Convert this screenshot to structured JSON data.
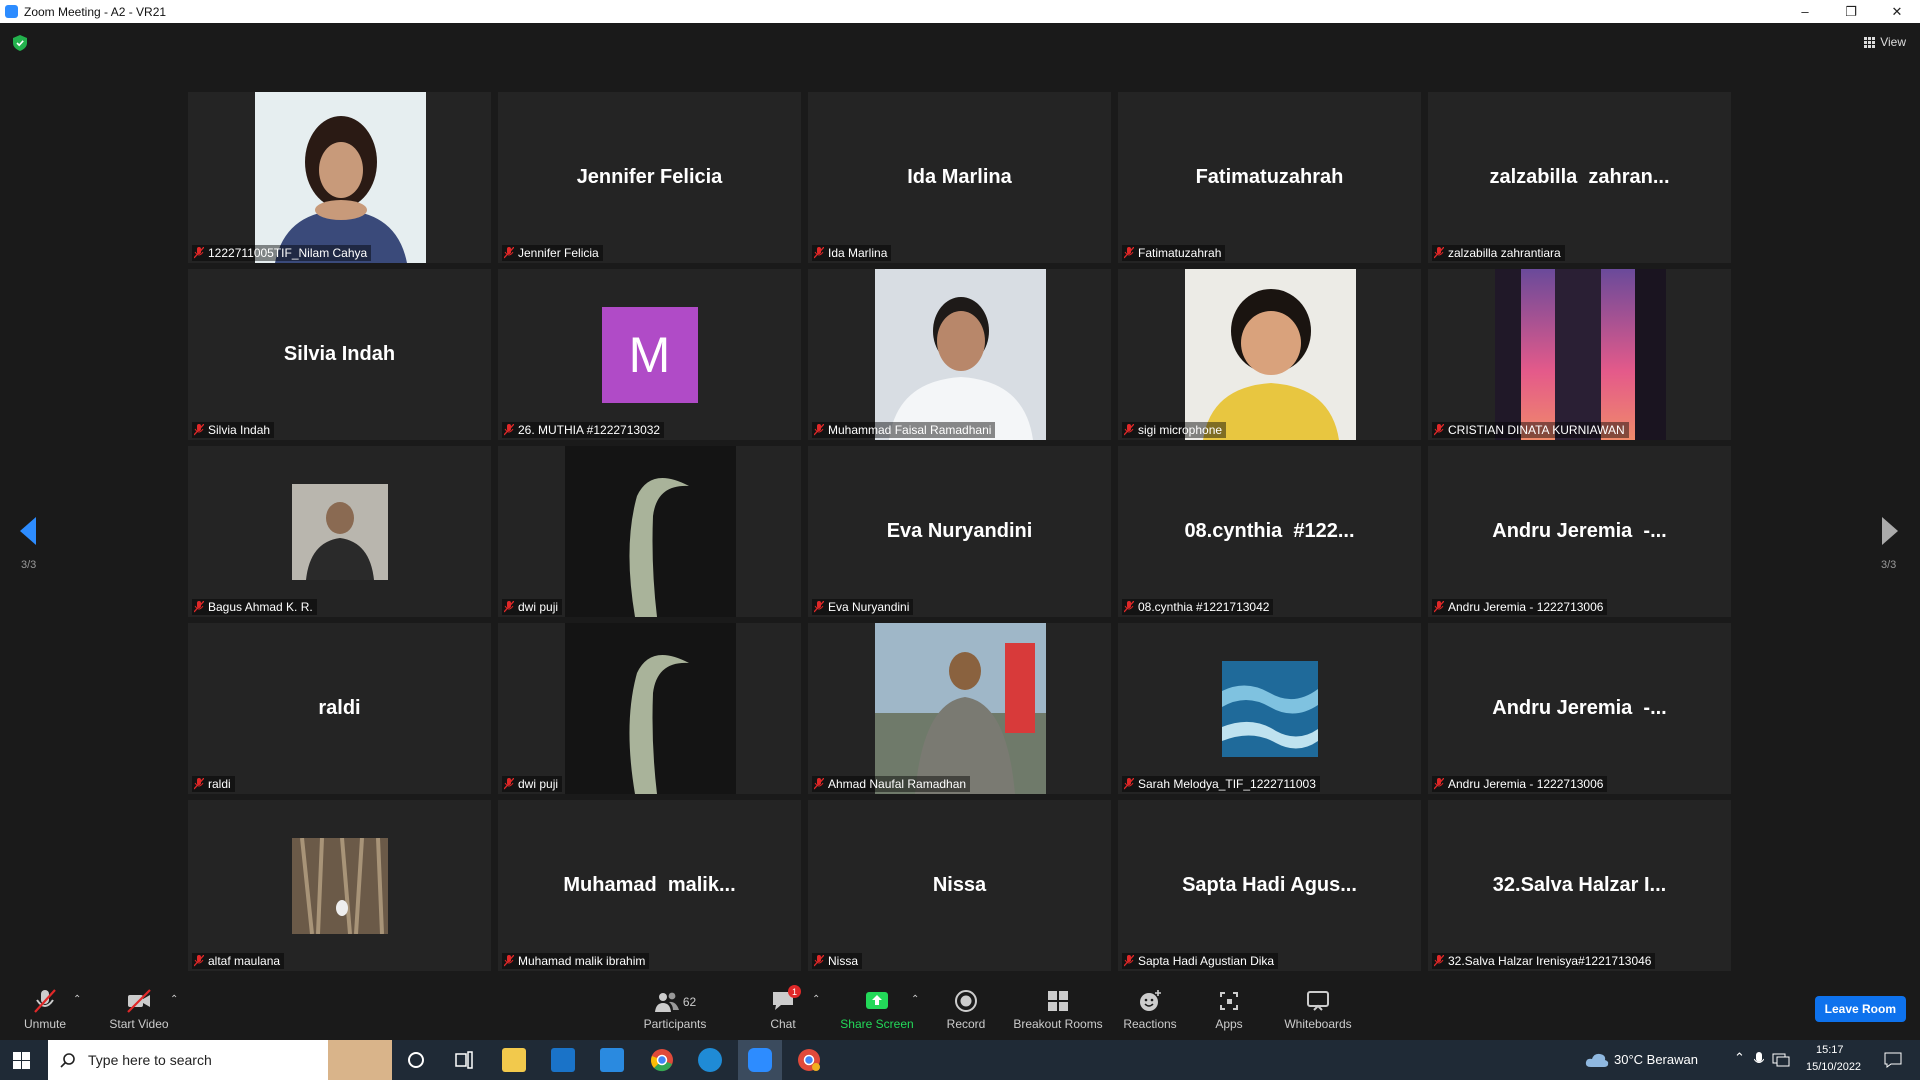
{
  "window": {
    "title": "Zoom Meeting - A2 - VR21",
    "minimize": "–",
    "restore": "❐",
    "close": "✕"
  },
  "header": {
    "view_label": "View"
  },
  "pager": {
    "left_indicator": "3/3",
    "right_indicator": "3/3"
  },
  "tiles": [
    {
      "display": "",
      "label": "1222711005TIF_Nilam Cahya",
      "video": "portrait-girl"
    },
    {
      "display": "Jennifer Felicia",
      "label": "Jennifer Felicia"
    },
    {
      "display": "Ida Marlina",
      "label": "Ida Marlina"
    },
    {
      "display": "Fatimatuzahrah",
      "label": "Fatimatuzahrah"
    },
    {
      "display": "zalzabilla  zahran...",
      "label": "zalzabilla zahrantiara"
    },
    {
      "display": "Silvia Indah",
      "label": "Silvia Indah"
    },
    {
      "display": "",
      "label": "26. MUTHIA #1222713032",
      "letter": "M"
    },
    {
      "display": "",
      "label": "Muhammad Faisal Ramadhani",
      "video": "portrait-man"
    },
    {
      "display": "",
      "label": "sigi microphone",
      "video": "child"
    },
    {
      "display": "",
      "label": "CRISTIAN DINATA KURNIAWAN",
      "video": "sunset-building"
    },
    {
      "display": "",
      "label": "Bagus Ahmad K. R.",
      "video": "small-photo"
    },
    {
      "display": "",
      "label": "dwi puji",
      "video": "leaf"
    },
    {
      "display": "Eva Nuryandini",
      "label": "Eva Nuryandini"
    },
    {
      "display": "08.cynthia  #122...",
      "label": "08.cynthia #1221713042"
    },
    {
      "display": "Andru Jeremia  -...",
      "label": "Andru Jeremia - 1222713006"
    },
    {
      "display": "raldi",
      "label": "raldi"
    },
    {
      "display": "",
      "label": "dwi puji",
      "video": "leaf"
    },
    {
      "display": "",
      "label": "Ahmad Naufal Ramadhan",
      "video": "speaker"
    },
    {
      "display": "",
      "label": "Sarah Melodya_TIF_1222711003",
      "video": "ocean"
    },
    {
      "display": "Andru Jeremia  -...",
      "label": "Andru Jeremia - 1222713006"
    },
    {
      "display": "",
      "label": "altaf maulana",
      "video": "forest"
    },
    {
      "display": "Muhamad  malik...",
      "label": "Muhamad malik ibrahim"
    },
    {
      "display": "Nissa",
      "label": "Nissa"
    },
    {
      "display": "Sapta Hadi Agus...",
      "label": "Sapta Hadi Agustian Dika"
    },
    {
      "display": "32.Salva Halzar I...",
      "label": "32.Salva Halzar Irenisya#1221713046"
    }
  ],
  "toolbar": {
    "unmute": "Unmute",
    "start_video": "Start Video",
    "participants": "Participants",
    "participants_count": "62",
    "chat": "Chat",
    "chat_badge": "1",
    "share_screen": "Share Screen",
    "record": "Record",
    "breakout_rooms": "Breakout Rooms",
    "reactions": "Reactions",
    "apps": "Apps",
    "whiteboards": "Whiteboards",
    "leave": "Leave Room"
  },
  "taskbar": {
    "search_placeholder": "Type here to search",
    "weather": "30°C  Berawan",
    "time": "15:17",
    "date": "15/10/2022"
  },
  "colors": {
    "share_green": "#23d959",
    "leave_blue": "#0e72ed",
    "muted_red": "#e02828",
    "pager_blue": "#2d8cff"
  }
}
